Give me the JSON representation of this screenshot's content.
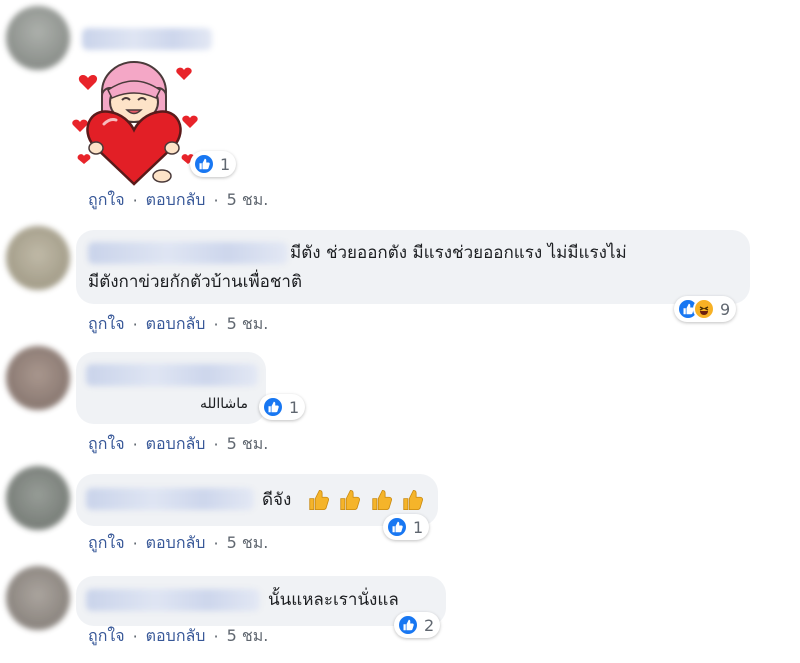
{
  "comments": [
    {
      "text": "",
      "actions": {
        "like": "ถูกใจ",
        "reply": "ตอบกลับ",
        "time": "5 ชม."
      },
      "reaction_count": "1",
      "avatar_color": "#8a8f8a"
    },
    {
      "text_line1": "มีตัง ช่วยออกตัง มีแรงช่วยออกแรง ไม่มีแรงไม่",
      "text_line2": "มีตังกาข่วยกักตัวบ้านเพื่อชาติ",
      "actions": {
        "like": "ถูกใจ",
        "reply": "ตอบกลับ",
        "time": "5 ชม."
      },
      "reaction_count": "9",
      "avatar_color": "#a39a86"
    },
    {
      "text": "ماشاالله",
      "actions": {
        "like": "ถูกใจ",
        "reply": "ตอบกลับ",
        "time": "5 ชม."
      },
      "reaction_count": "1",
      "avatar_color": "#8d7a72"
    },
    {
      "text": "ดีจัง",
      "actions": {
        "like": "ถูกใจ",
        "reply": "ตอบกลับ",
        "time": "5 ชม."
      },
      "reaction_count": "1",
      "avatar_color": "#707670"
    },
    {
      "text": "นั้นแหละเรานั่งแล",
      "actions": {
        "like": "ถูกใจ",
        "reply": "ตอบกลับ",
        "time": "5 ชม."
      },
      "reaction_count": "2",
      "avatar_color": "#8a8580"
    }
  ],
  "actions_separator": "·",
  "colors": {
    "link": "#385898",
    "like_blue": "#1877f2",
    "bubble": "#f0f2f5"
  },
  "icons": {
    "like": "thumbs-up-icon",
    "haha": "haha-face-icon",
    "sticker": "girl-holding-heart-sticker"
  }
}
